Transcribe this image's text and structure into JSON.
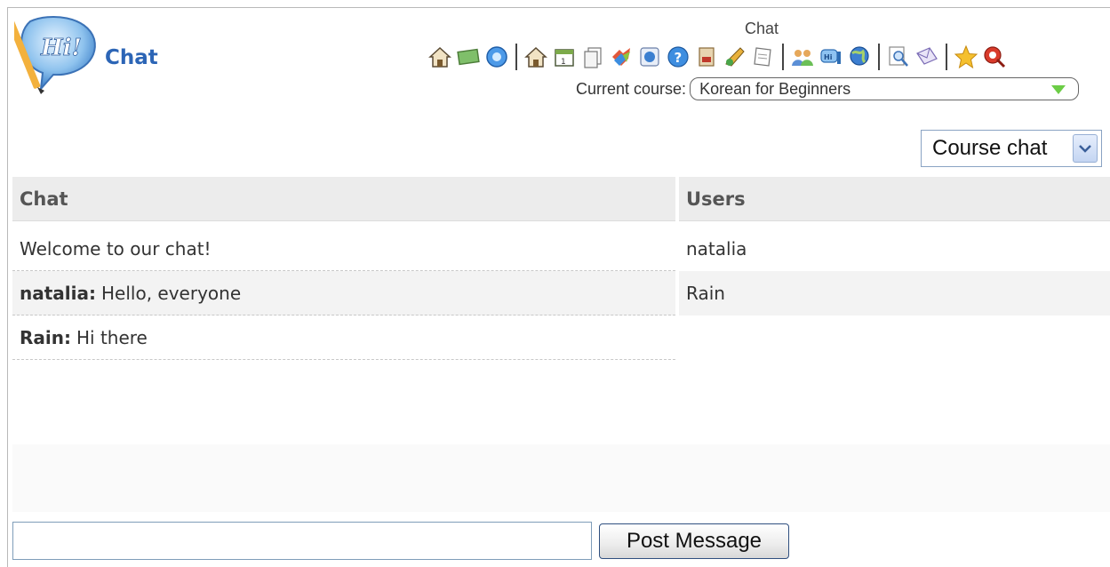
{
  "header": {
    "app_title": "Chat",
    "page_heading": "Chat",
    "course_label": "Current course:",
    "course_value": "Korean for Beginners"
  },
  "toolbar": {
    "icons": [
      "home-icon",
      "whiteboard-icon",
      "globe-icon",
      "home-icon",
      "calendar-icon",
      "documents-icon",
      "links-icon",
      "web-icon",
      "help-icon",
      "dropbox-icon",
      "edit-icon",
      "notes-icon",
      "users-icon",
      "chat-icon",
      "network-icon",
      "search-icon",
      "mail-icon",
      "favorites-icon",
      "logout-icon"
    ]
  },
  "chat_select": {
    "value": "Course chat"
  },
  "chat": {
    "header": "Chat",
    "messages": [
      {
        "author": "",
        "text": "Welcome to our chat!"
      },
      {
        "author": "natalia:",
        "text": "Hello, everyone"
      },
      {
        "author": "Rain:",
        "text": "Hi there"
      }
    ]
  },
  "users": {
    "header": "Users",
    "list": [
      "natalia",
      "Rain"
    ]
  },
  "composer": {
    "input_value": "",
    "post_label": "Post Message"
  },
  "colors": {
    "accent": "#2c65b6",
    "header_bg": "#ececec",
    "alt_row": "#f3f3f3",
    "course_arrow": "#6ccd46"
  }
}
